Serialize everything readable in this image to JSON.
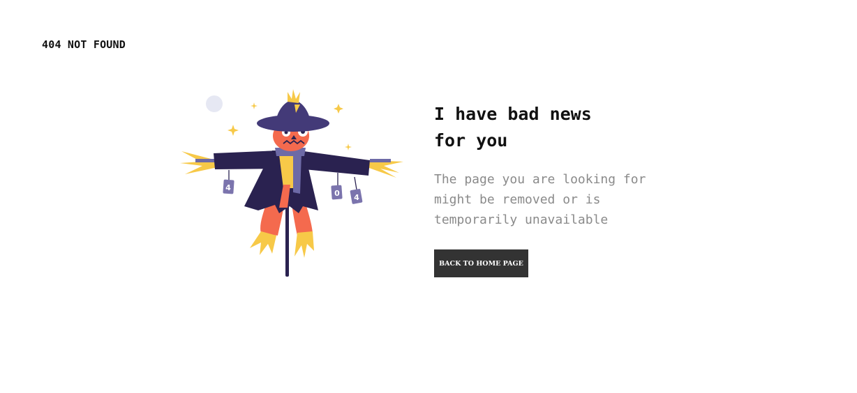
{
  "header": {
    "brand": "404 NOT FOUND"
  },
  "illustration": {
    "icon": "scarecrow-illustration",
    "tags": [
      "4",
      "0",
      "4"
    ]
  },
  "message": {
    "headline_line1": "I have bad news",
    "headline_line2": "for you",
    "description": "The page you are looking for might be removed or is temporarily unavailable"
  },
  "actions": {
    "home_label": "BACK TO HOME PAGE"
  },
  "colors": {
    "button_bg": "#333333",
    "text": "#111111",
    "muted": "#8a8a8a",
    "accent_orange": "#f46a4e",
    "accent_purple": "#3b2e6a",
    "accent_yellow": "#f7c948"
  }
}
